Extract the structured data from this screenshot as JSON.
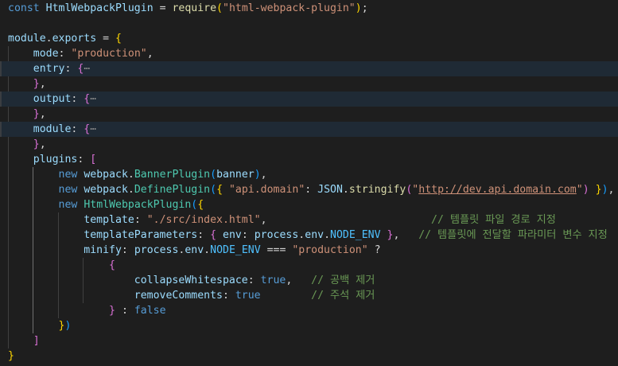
{
  "editor": {
    "lines": [
      {
        "segments": [
          {
            "t": "const",
            "c": "kw"
          },
          {
            "t": " "
          },
          {
            "t": "HtmlWebpackPlugin",
            "c": "var"
          },
          {
            "t": " = "
          },
          {
            "t": "require",
            "c": "fn"
          },
          {
            "t": "(",
            "c": "br1"
          },
          {
            "t": "\"html-webpack-plugin\"",
            "c": "str"
          },
          {
            "t": ")",
            "c": "br1"
          },
          {
            "t": ";"
          }
        ]
      },
      {
        "segments": []
      },
      {
        "segments": [
          {
            "t": "module",
            "c": "var"
          },
          {
            "t": "."
          },
          {
            "t": "exports",
            "c": "var"
          },
          {
            "t": " = "
          },
          {
            "t": "{",
            "c": "br1"
          }
        ]
      },
      {
        "segments": [
          {
            "t": "    "
          },
          {
            "t": "mode",
            "c": "var"
          },
          {
            "t": ": "
          },
          {
            "t": "\"production\"",
            "c": "str"
          },
          {
            "t": ","
          }
        ]
      },
      {
        "highlight": true,
        "segments": [
          {
            "t": "    "
          },
          {
            "t": "entry",
            "c": "var"
          },
          {
            "t": ": "
          },
          {
            "t": "{",
            "c": "br2"
          },
          {
            "t": "⋯",
            "c": "ell"
          }
        ]
      },
      {
        "segments": [
          {
            "t": "    "
          },
          {
            "t": "}",
            "c": "br2"
          },
          {
            "t": ","
          }
        ]
      },
      {
        "highlight": true,
        "segments": [
          {
            "t": "    "
          },
          {
            "t": "output",
            "c": "var"
          },
          {
            "t": ": "
          },
          {
            "t": "{",
            "c": "br2"
          },
          {
            "t": "⋯",
            "c": "ell"
          }
        ]
      },
      {
        "segments": [
          {
            "t": "    "
          },
          {
            "t": "}",
            "c": "br2"
          },
          {
            "t": ","
          }
        ]
      },
      {
        "highlight": true,
        "segments": [
          {
            "t": "    "
          },
          {
            "t": "module",
            "c": "var"
          },
          {
            "t": ": "
          },
          {
            "t": "{",
            "c": "br2"
          },
          {
            "t": "⋯",
            "c": "ell"
          }
        ]
      },
      {
        "segments": [
          {
            "t": "    "
          },
          {
            "t": "}",
            "c": "br2"
          },
          {
            "t": ","
          }
        ]
      },
      {
        "segments": [
          {
            "t": "    "
          },
          {
            "t": "plugins",
            "c": "var"
          },
          {
            "t": ": "
          },
          {
            "t": "[",
            "c": "br2"
          }
        ]
      },
      {
        "segments": [
          {
            "t": "        "
          },
          {
            "t": "new",
            "c": "kw"
          },
          {
            "t": " "
          },
          {
            "t": "webpack",
            "c": "var"
          },
          {
            "t": "."
          },
          {
            "t": "BannerPlugin",
            "c": "cls"
          },
          {
            "t": "(",
            "c": "br3"
          },
          {
            "t": "banner",
            "c": "var"
          },
          {
            "t": ")",
            "c": "br3"
          },
          {
            "t": ","
          }
        ]
      },
      {
        "segments": [
          {
            "t": "        "
          },
          {
            "t": "new",
            "c": "kw"
          },
          {
            "t": " "
          },
          {
            "t": "webpack",
            "c": "var"
          },
          {
            "t": "."
          },
          {
            "t": "DefinePlugin",
            "c": "cls"
          },
          {
            "t": "(",
            "c": "br3"
          },
          {
            "t": "{",
            "c": "br1"
          },
          {
            "t": " "
          },
          {
            "t": "\"api.domain\"",
            "c": "str"
          },
          {
            "t": ": "
          },
          {
            "t": "JSON",
            "c": "var"
          },
          {
            "t": "."
          },
          {
            "t": "stringify",
            "c": "fn"
          },
          {
            "t": "(",
            "c": "br2"
          },
          {
            "t": "\"",
            "c": "str"
          },
          {
            "t": "http://dev.api.domain.com",
            "c": "url"
          },
          {
            "t": "\"",
            "c": "str"
          },
          {
            "t": ")",
            "c": "br2"
          },
          {
            "t": " "
          },
          {
            "t": "}",
            "c": "br1"
          },
          {
            "t": ")",
            "c": "br3"
          },
          {
            "t": ","
          }
        ]
      },
      {
        "segments": [
          {
            "t": "        "
          },
          {
            "t": "new",
            "c": "kw"
          },
          {
            "t": " "
          },
          {
            "t": "HtmlWebpackPlugin",
            "c": "cls"
          },
          {
            "t": "(",
            "c": "br3"
          },
          {
            "t": "{",
            "c": "br1"
          }
        ]
      },
      {
        "segments": [
          {
            "t": "            "
          },
          {
            "t": "template",
            "c": "var"
          },
          {
            "t": ": "
          },
          {
            "t": "\"./src/index.html\"",
            "c": "str"
          },
          {
            "t": ",                          "
          },
          {
            "t": "// 템플릿 파일 경로 지정",
            "c": "cmt"
          }
        ]
      },
      {
        "segments": [
          {
            "t": "            "
          },
          {
            "t": "templateParameters",
            "c": "var"
          },
          {
            "t": ": "
          },
          {
            "t": "{",
            "c": "br2"
          },
          {
            "t": " "
          },
          {
            "t": "env",
            "c": "var"
          },
          {
            "t": ": "
          },
          {
            "t": "process",
            "c": "var"
          },
          {
            "t": "."
          },
          {
            "t": "env",
            "c": "var"
          },
          {
            "t": "."
          },
          {
            "t": "NODE_ENV",
            "c": "const"
          },
          {
            "t": " "
          },
          {
            "t": "}",
            "c": "br2"
          },
          {
            "t": ",   "
          },
          {
            "t": "// 템플릿에 전달할 파라미터 변수 지정",
            "c": "cmt"
          }
        ]
      },
      {
        "segments": [
          {
            "t": "            "
          },
          {
            "t": "minify",
            "c": "var"
          },
          {
            "t": ": "
          },
          {
            "t": "process",
            "c": "var"
          },
          {
            "t": "."
          },
          {
            "t": "env",
            "c": "var"
          },
          {
            "t": "."
          },
          {
            "t": "NODE_ENV",
            "c": "const"
          },
          {
            "t": " === "
          },
          {
            "t": "\"production\"",
            "c": "str"
          },
          {
            "t": " ?"
          }
        ]
      },
      {
        "segments": [
          {
            "t": "                "
          },
          {
            "t": "{",
            "c": "br2"
          }
        ]
      },
      {
        "segments": [
          {
            "t": "                    "
          },
          {
            "t": "collapseWhitespace",
            "c": "var"
          },
          {
            "t": ": "
          },
          {
            "t": "true",
            "c": "kw"
          },
          {
            "t": ",   "
          },
          {
            "t": "// 공백 제거",
            "c": "cmt"
          }
        ]
      },
      {
        "segments": [
          {
            "t": "                    "
          },
          {
            "t": "removeComments",
            "c": "var"
          },
          {
            "t": ": "
          },
          {
            "t": "true",
            "c": "kw"
          },
          {
            "t": "        "
          },
          {
            "t": "// 주석 제거",
            "c": "cmt"
          }
        ]
      },
      {
        "segments": [
          {
            "t": "                "
          },
          {
            "t": "}",
            "c": "br2"
          },
          {
            "t": " : "
          },
          {
            "t": "false",
            "c": "kw"
          }
        ]
      },
      {
        "segments": [
          {
            "t": "        "
          },
          {
            "t": "}",
            "c": "br1"
          },
          {
            "t": ")",
            "c": "br3"
          }
        ]
      },
      {
        "segments": [
          {
            "t": "    "
          },
          {
            "t": "]",
            "c": "br2"
          }
        ]
      },
      {
        "segments": [
          {
            "t": "}",
            "c": "br1"
          }
        ]
      }
    ]
  },
  "theme": {
    "background": "#1e1e1e",
    "line_highlight": "#1f2a35",
    "indent_guide": "#404040"
  }
}
